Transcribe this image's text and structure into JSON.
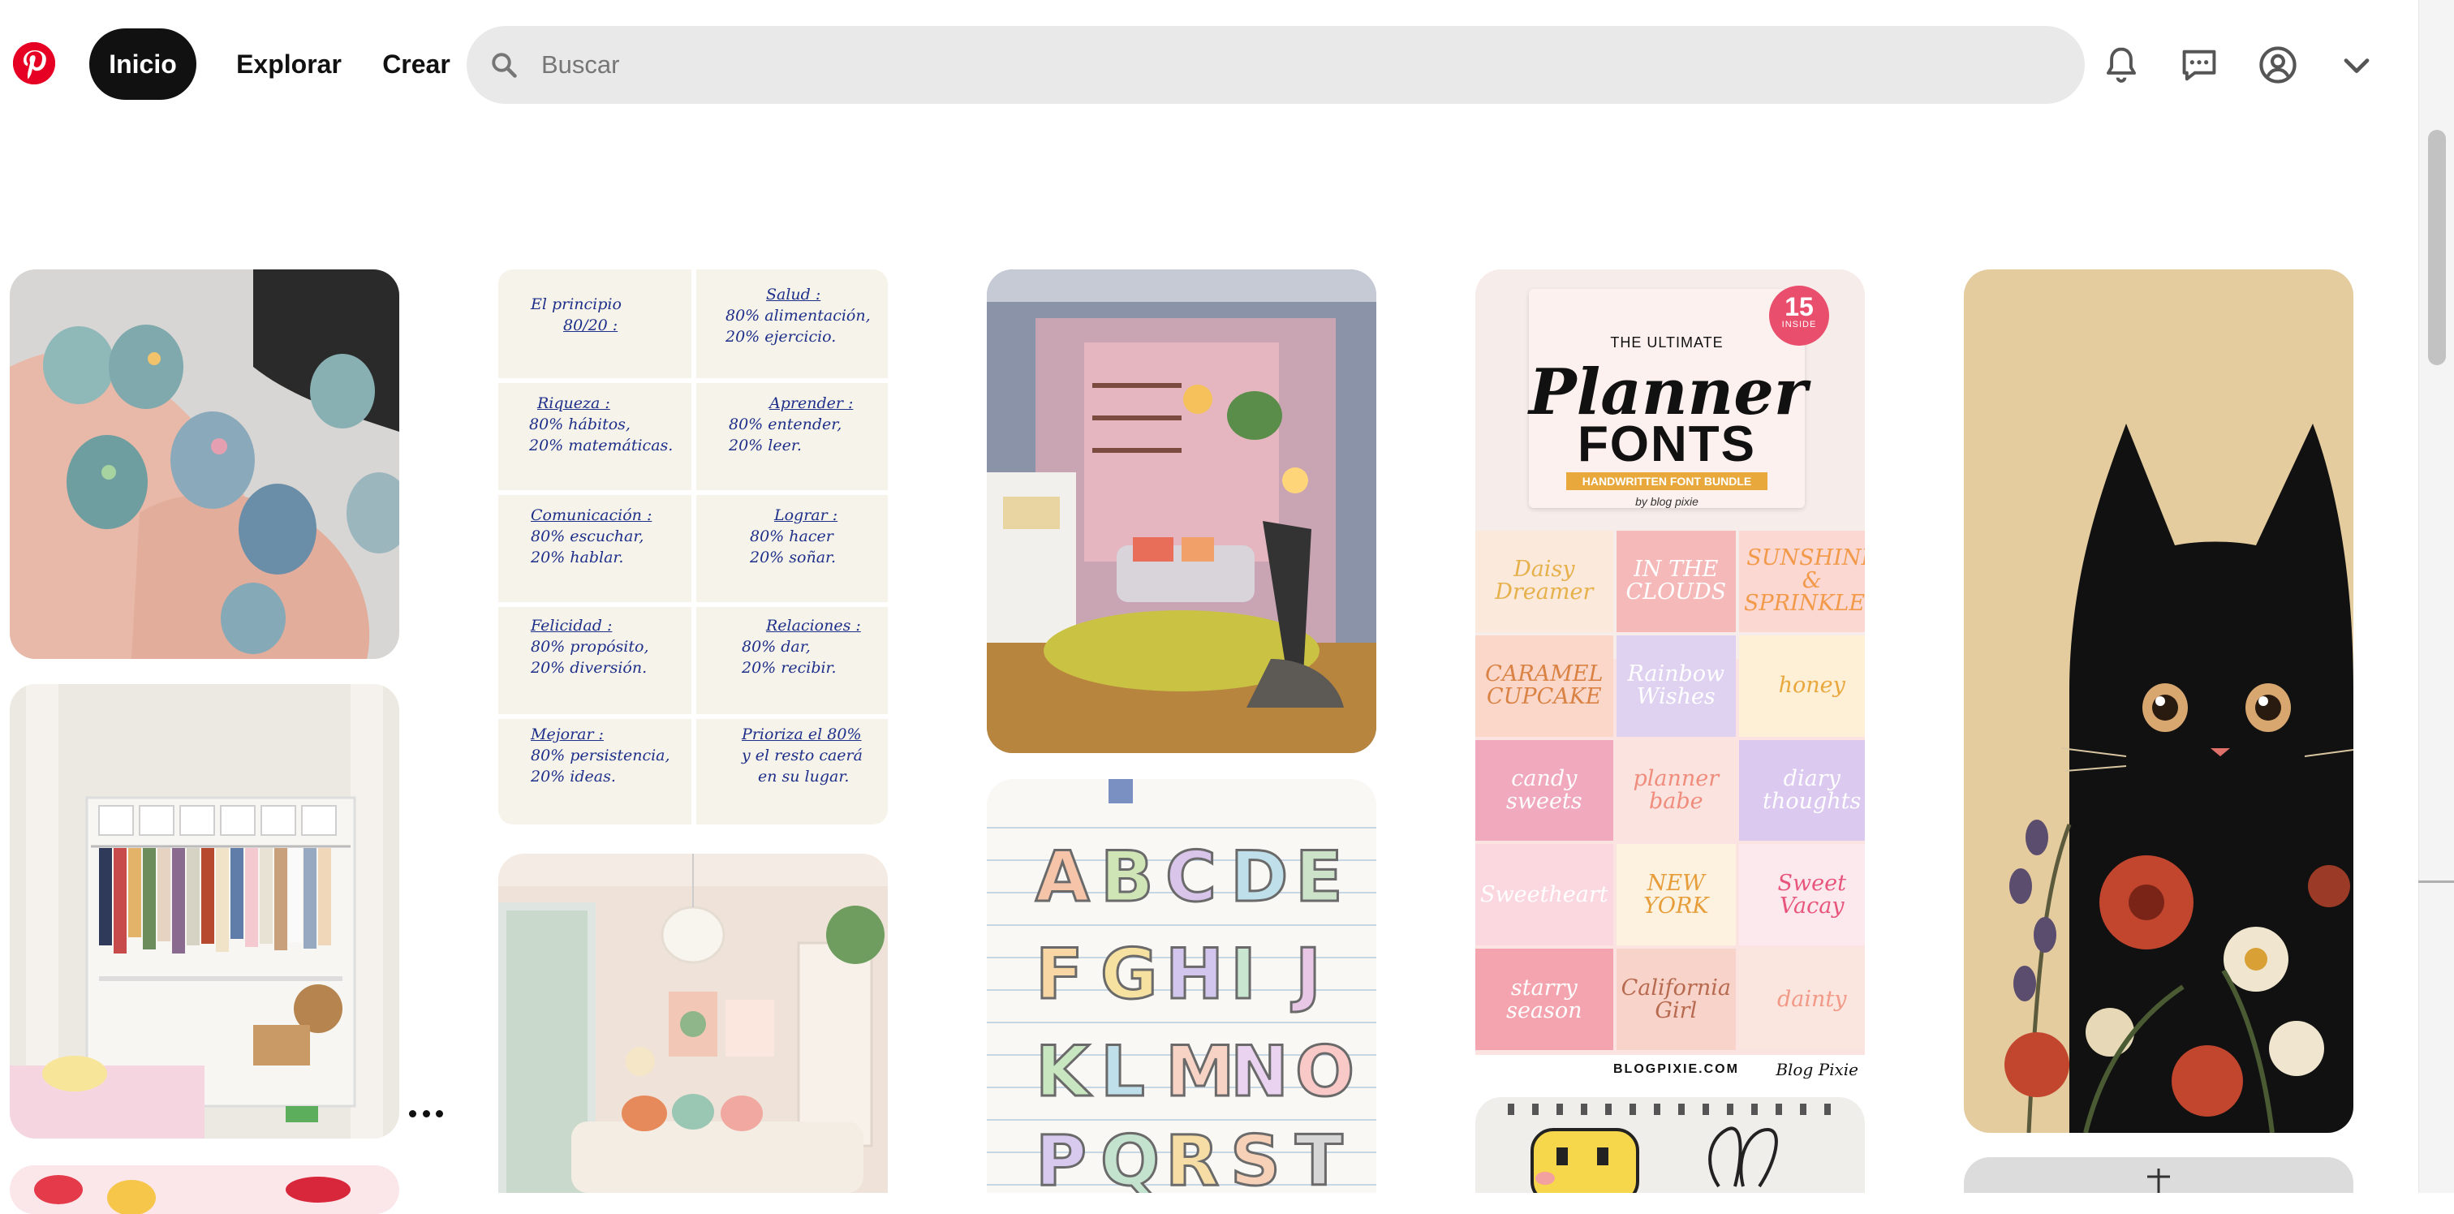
{
  "header": {
    "logo": "pinterest-logo",
    "nav": {
      "home_label": "Inicio",
      "explore_label": "Explorar",
      "create_label": "Crear"
    },
    "search": {
      "placeholder": "Buscar",
      "value": ""
    },
    "icons": [
      "bell-icon",
      "message-icon",
      "user-circle-icon",
      "chevron-down-icon"
    ]
  },
  "feed": {
    "more_menu_label": "•••",
    "eighty_twenty": {
      "cells": [
        {
          "title": "El principio",
          "lines": [
            "80/20 :"
          ]
        },
        {
          "title": "Salud :",
          "lines": [
            "80% alimentación,",
            "20% ejercicio."
          ]
        },
        {
          "title": "Riqueza :",
          "lines": [
            "80% hábitos,",
            "20% matemáticas."
          ]
        },
        {
          "title": "Aprender :",
          "lines": [
            "80% entender,",
            "20% leer."
          ]
        },
        {
          "title": "Comunicación :",
          "lines": [
            "80% escuchar,",
            "20% hablar."
          ]
        },
        {
          "title": "Lograr :",
          "lines": [
            "80% hacer",
            "20% soñar."
          ]
        },
        {
          "title": "Felicidad :",
          "lines": [
            "80% propósito,",
            "20% diversión."
          ]
        },
        {
          "title": "Relaciones :",
          "lines": [
            "80% dar,",
            "20% recibir."
          ]
        },
        {
          "title": "Mejorar :",
          "lines": [
            "80% persistencia,",
            "20% ideas."
          ]
        },
        {
          "title": "Prioriza el 80%",
          "lines": [
            "y el resto caerá",
            "en su lugar."
          ]
        }
      ]
    },
    "planner": {
      "badge_number": "15",
      "badge_text": "INSIDE",
      "subtitle": "THE ULTIMATE",
      "title_line1": "Planner",
      "title_line2": "FONTS",
      "banner": "HANDWRITTEN FONT BUNDLE",
      "byline": "by blog pixie",
      "tiles": [
        "Daisy Dreamer",
        "IN THE CLOUDS",
        "SUNSHINE & SPRINKLES",
        "CARAMEL CUPCAKE",
        "Rainbow Wishes",
        "honey",
        "candy sweets",
        "planner babe",
        "diary thoughts",
        "Sweetheart",
        "NEW YORK",
        "Sweet Vacay",
        "starry season",
        "California Girl",
        "dainty"
      ],
      "footer": "BLOGPIXIE.COM",
      "signature": "Blog Pixie"
    },
    "alphabet_letters": [
      "A",
      "B",
      "C",
      "D",
      "E",
      "F",
      "G",
      "H",
      "I",
      "J",
      "K",
      "L",
      "M",
      "N",
      "O",
      "P",
      "Q",
      "R",
      "S",
      "T"
    ]
  },
  "colors": {
    "brand": "#e60023",
    "nav_active_bg": "#111111",
    "search_bg": "#e9e9e9",
    "ink_blue": "#1e2f8a"
  }
}
